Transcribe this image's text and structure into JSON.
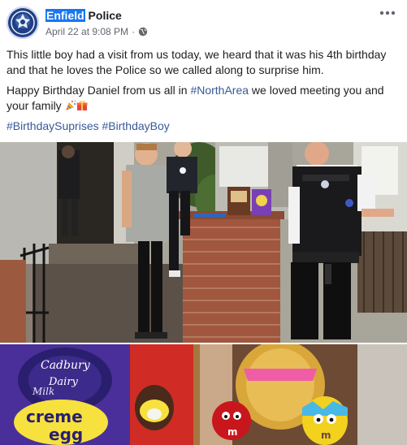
{
  "post": {
    "author": {
      "name_highlight": "Enfield",
      "name_rest": " Police"
    },
    "timestamp": "April 22 at 9:08 PM",
    "separator": "·",
    "audience_icon": "globe-icon",
    "menu_icon": "more-dots-icon",
    "paragraph1": "This little boy had a visit from us today, we heard that it was his 4th birthday and that he loves the Police so we called along to surprise him.",
    "paragraph2_before": "Happy Birthday Daniel from us all in ",
    "paragraph2_tag": "#NorthArea",
    "paragraph2_after": " we loved meeting you and your family",
    "emojis": [
      "party-popper-icon",
      "gift-icon"
    ],
    "hashtags": [
      "#BirthdaySuprises",
      "#BirthdayBoy"
    ],
    "colors": {
      "link": "#385898",
      "highlight": "#1877f2",
      "meta": "#606770"
    }
  },
  "photos": {
    "photo1_label": "",
    "photo2": {
      "egg_box_brand": "Cadbury",
      "egg_box_line1": "Dairy",
      "egg_box_line2": "Milk",
      "egg_box_line3": "creme",
      "egg_box_line4": "egg",
      "candy_brand": "m"
    }
  }
}
